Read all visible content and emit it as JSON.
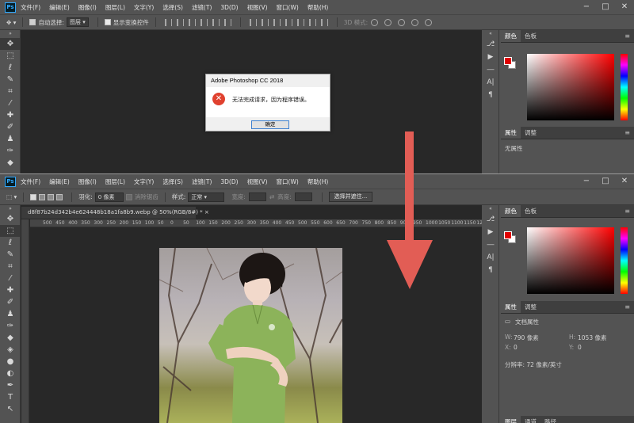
{
  "menu": [
    "文件(F)",
    "编辑(E)",
    "图像(I)",
    "图层(L)",
    "文字(Y)",
    "选择(S)",
    "滤镜(T)",
    "3D(D)",
    "视图(V)",
    "窗口(W)",
    "帮助(H)"
  ],
  "window_controls": {
    "minimize": "−",
    "maximize": "□",
    "close": "✕"
  },
  "top_options": {
    "auto_select_label": "自动选择:",
    "auto_select_value": "图层",
    "show_transform_label": "显示变换控件",
    "mode_3d_label": "3D 模式:"
  },
  "bottom_options": {
    "feather_label": "羽化:",
    "feather_value": "0 像素",
    "antialias_label": "消除锯齿",
    "style_label": "样式:",
    "style_value": "正常",
    "width_label": "宽度:",
    "height_label": "高度:",
    "select_mask_button": "选择并遮住..."
  },
  "document_tab": "d8f87b24d342b4e624448b18a1fa8b9.webp @ 50%(RGB/8#) * ×",
  "ruler_numbers": [
    "500",
    "450",
    "400",
    "350",
    "300",
    "250",
    "200",
    "150",
    "100",
    "50",
    "0",
    "50",
    "100",
    "150",
    "200",
    "250",
    "300",
    "350",
    "400",
    "450",
    "500",
    "550",
    "600",
    "650",
    "700",
    "750",
    "800",
    "850",
    "900",
    "950",
    "1000",
    "1050",
    "1100",
    "1150",
    "1200",
    "1250"
  ],
  "dialog": {
    "title": "Adobe Photoshop CC 2018",
    "message": "无法完成请求，因为程序错误。",
    "ok_button": "确定"
  },
  "panels": {
    "color_tab": "颜色",
    "swatches_tab": "色板",
    "properties_tab": "属性",
    "adjustments_tab": "调整",
    "no_properties": "无属性",
    "doc_properties": "文档属性",
    "width_label": "W:",
    "width_value": "790 像素",
    "height_label": "H:",
    "height_value": "1053 像素",
    "x_label": "X:",
    "x_value": "0",
    "y_label": "Y:",
    "y_value": "0",
    "resolution": "分辨率: 72 像素/英寸",
    "layers_tab": "图层",
    "channels_tab": "通道",
    "paths_tab": "路径"
  },
  "colors": {
    "accent_red": "#e25d55",
    "error_red": "#e0412f",
    "ps_blue": "#31a8ff"
  }
}
